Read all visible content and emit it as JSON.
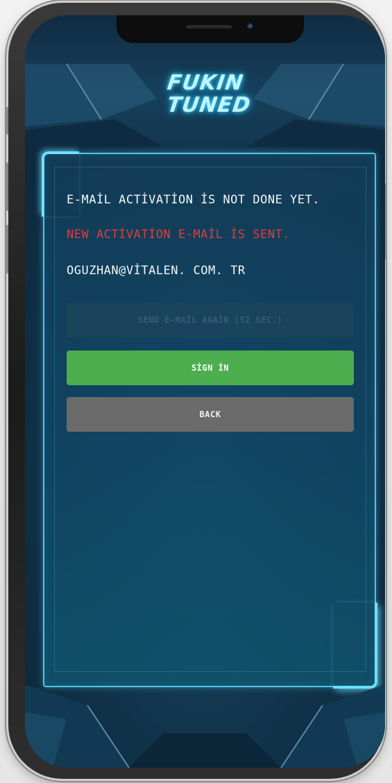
{
  "app": {
    "logo_line1": "FUKIN",
    "logo_line2": "TUNED"
  },
  "messages": {
    "not_done": "E-MAİL ACTİVATİON İS NOT DONE YET.",
    "sent": "NEW ACTİVATİON E-MAİL İS SENT.",
    "email": "OGUZHAN@VİTALEN. COM. TR"
  },
  "buttons": {
    "resend": "SEND E-MAİL AGAİN (52 SEC.)",
    "signin": "SİGN İN",
    "back": "BACK"
  },
  "colors": {
    "accent_glow": "#4fc3ea",
    "error_text": "#e23c3c",
    "signin_bg": "#4cae4f",
    "back_bg": "#6b6b6b"
  }
}
